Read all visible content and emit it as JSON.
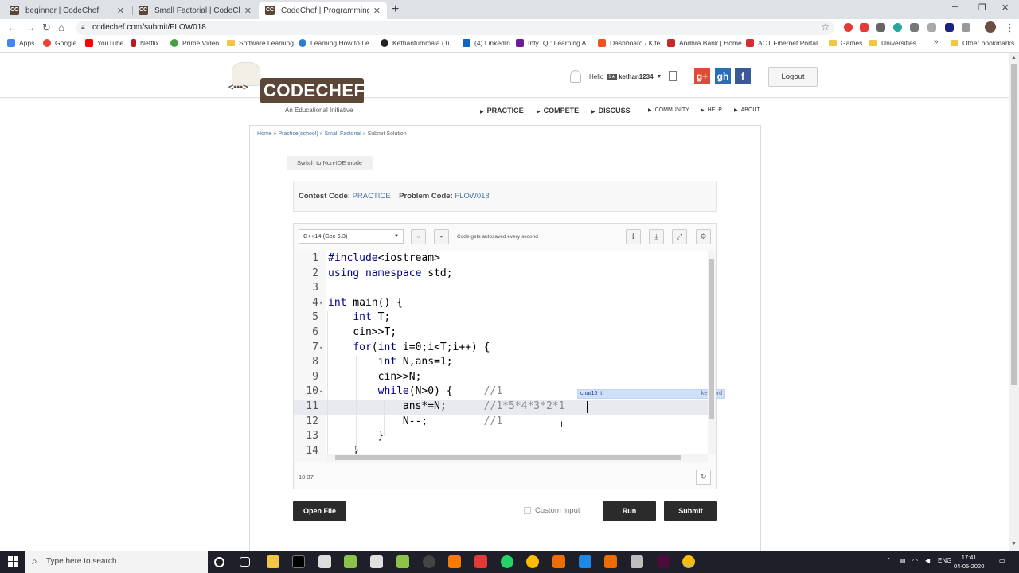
{
  "browser": {
    "tabs": [
      {
        "title": "beginner | CodeChef",
        "active": false
      },
      {
        "title": "Small Factorial | CodeChef",
        "active": false
      },
      {
        "title": "CodeChef | Programming Compe",
        "active": true
      }
    ],
    "url": "codechef.com/submit/FLOW018",
    "bookmarks": [
      "Apps",
      "Google",
      "YouTube",
      "Netflix",
      "Prime Video",
      "Software Learning",
      "Learning How to Le...",
      "Kethantummala (Tu...",
      "(4) LinkedIn",
      "InfyTQ : Learning A...",
      "Dashboard / Kite",
      "Andhra Bank | Home",
      "ACT Fibernet Portal...",
      "Games",
      "Universities"
    ],
    "other_bookmarks": "Other bookmarks",
    "more_bookmarks": "»"
  },
  "header": {
    "logo_text": "CODECHEF",
    "logo_face": "<•••>",
    "tagline": "An Educational Initiative",
    "hello": "Hello",
    "rating_badge": "1★",
    "username": "kethan1234",
    "logout_label": "Logout",
    "social": [
      "g+",
      "gh",
      "f"
    ],
    "nav_main": [
      "PRACTICE",
      "COMPETE",
      "DISCUSS"
    ],
    "nav_small": [
      "COMMUNITY",
      "HELP",
      "ABOUT"
    ]
  },
  "breadcrumb": {
    "items": [
      "Home",
      "Practice(school)",
      "Small Factorial"
    ],
    "current": "Submit Solution",
    "separator": "»"
  },
  "ide_toggle_label": "Switch to Non-IDE mode",
  "contest": {
    "contest_label": "Contest Code:",
    "contest_value": "PRACTICE",
    "problem_label": "Problem Code:",
    "problem_value": "FLOW018"
  },
  "editor": {
    "language": "C++14 (Gcc 6.3)",
    "autosave_note": "Code gets autosaved every second",
    "cursor_position": "10:37",
    "lines": [
      {
        "n": "1",
        "fold": "",
        "code": "#include<iostream>"
      },
      {
        "n": "2",
        "fold": "",
        "code": "using namespace std;"
      },
      {
        "n": "3",
        "fold": "",
        "code": ""
      },
      {
        "n": "4",
        "fold": "▾",
        "code": "int main() {"
      },
      {
        "n": "5",
        "fold": "",
        "code": "    int T;"
      },
      {
        "n": "6",
        "fold": "",
        "code": "    cin>>T;"
      },
      {
        "n": "7",
        "fold": "▾",
        "code": "    for(int i=0;i<T;i++) {"
      },
      {
        "n": "8",
        "fold": "",
        "code": "        int N,ans=1;"
      },
      {
        "n": "9",
        "fold": "",
        "code": "        cin>>N;"
      },
      {
        "n": "10",
        "fold": "▾",
        "code": "        while(N>0) {     //1"
      },
      {
        "n": "11",
        "fold": "",
        "code": "            ans*=N;      //1*5*4*3*2*1"
      },
      {
        "n": "12",
        "fold": "",
        "code": "            N--;         //1"
      },
      {
        "n": "13",
        "fold": "",
        "code": "        }"
      },
      {
        "n": "14",
        "fold": "",
        "code": "    }"
      }
    ],
    "active_line": "11",
    "autocomplete": {
      "name": "char16_t",
      "kind": "keyword"
    }
  },
  "actions": {
    "open_file": "Open File",
    "custom_input": "Custom Input",
    "run": "Run",
    "submit": "Submit"
  },
  "taskbar": {
    "search_placeholder": "Type here to search",
    "lang": "ENG",
    "time": "17:41",
    "date": "04-05-2020"
  }
}
